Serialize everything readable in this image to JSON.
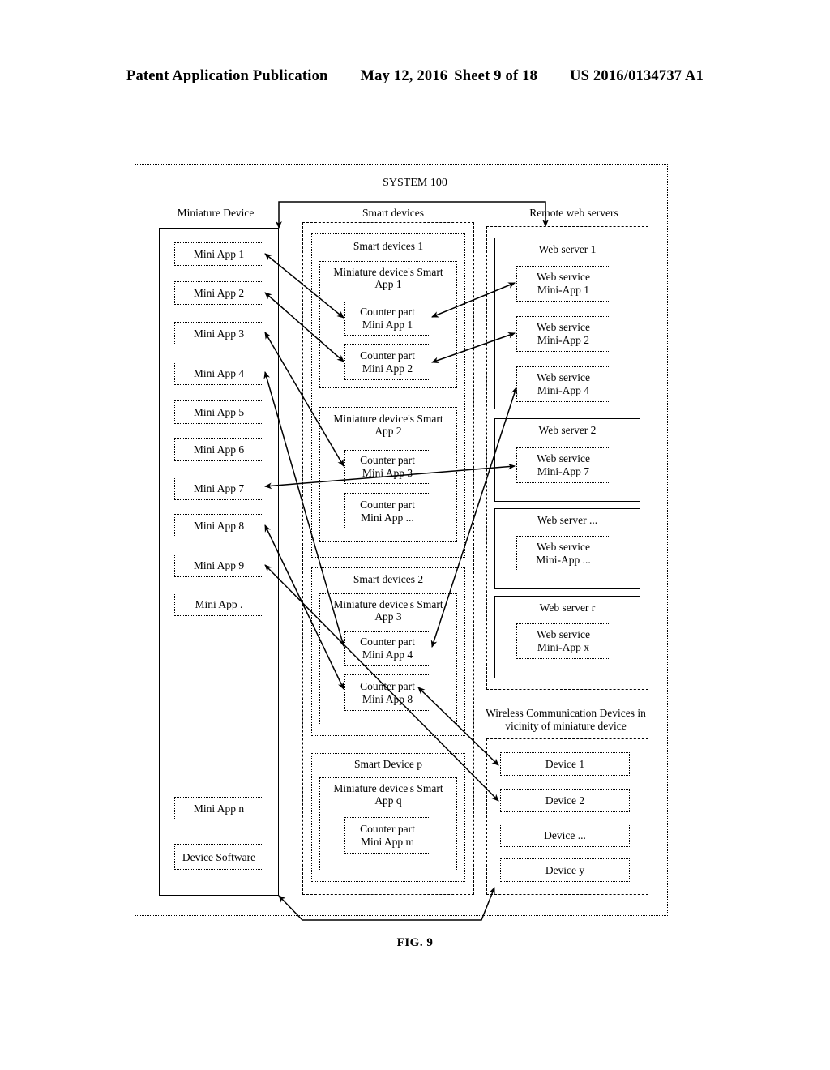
{
  "header": {
    "title": "Patent Application Publication",
    "date": "May 12, 2016",
    "sheet": "Sheet 9 of 18",
    "number": "US 2016/0134737 A1"
  },
  "figure": {
    "label": "FIG. 9",
    "system_title": "SYSTEM 100",
    "columns": {
      "miniature_device": {
        "caption": "Miniature Device",
        "items": [
          {
            "label": "Mini App 1"
          },
          {
            "label": "Mini App 2"
          },
          {
            "label": "Mini App 3"
          },
          {
            "label": "Mini App 4"
          },
          {
            "label": "Mini App 5"
          },
          {
            "label": "Mini App 6"
          },
          {
            "label": "Mini App 7"
          },
          {
            "label": "Mini App 8"
          },
          {
            "label": "Mini App 9"
          },
          {
            "label": "Mini App ."
          },
          {
            "label": "Mini App n"
          },
          {
            "label": "Device Software"
          }
        ]
      },
      "smart_devices": {
        "caption": "Smart devices",
        "groups": [
          {
            "title": "Smart devices 1",
            "apps": [
              {
                "title_line1": "Miniature device's Smart",
                "title_line2": "App 1",
                "parts": [
                  {
                    "line1": "Counter part",
                    "line2": "Mini App 1"
                  },
                  {
                    "line1": "Counter part",
                    "line2": "Mini App 2"
                  }
                ]
              },
              {
                "title_line1": "Miniature device's Smart",
                "title_line2": "App 2",
                "parts": [
                  {
                    "line1": "Counter part",
                    "line2": "Mini App 3"
                  },
                  {
                    "line1": "Counter part",
                    "line2": "Mini App ..."
                  }
                ]
              }
            ]
          },
          {
            "title": "Smart devices 2",
            "apps": [
              {
                "title_line1": "Miniature device's Smart",
                "title_line2": "App 3",
                "parts": [
                  {
                    "line1": "Counter part",
                    "line2": "Mini App 4"
                  },
                  {
                    "line1": "Counter part",
                    "line2": "Mini App 8"
                  }
                ]
              }
            ]
          },
          {
            "title": "Smart Device p",
            "apps": [
              {
                "title_line1": "Miniature device's Smart",
                "title_line2": "App q",
                "parts": [
                  {
                    "line1": "Counter part",
                    "line2": "Mini App m"
                  }
                ]
              }
            ]
          }
        ]
      },
      "remote_web_servers": {
        "caption": "Remote web servers",
        "servers": [
          {
            "title": "Web server 1",
            "services": [
              {
                "line1": "Web service",
                "line2": "Mini-App 1"
              },
              {
                "line1": "Web service",
                "line2": "Mini-App 2"
              },
              {
                "line1": "Web service",
                "line2": "Mini-App 4"
              }
            ]
          },
          {
            "title": "Web server 2",
            "services": [
              {
                "line1": "Web service",
                "line2": "Mini-App 7"
              }
            ]
          },
          {
            "title": "Web server ...",
            "services": [
              {
                "line1": "Web service",
                "line2": "Mini-App ..."
              }
            ]
          },
          {
            "title": "Web server r",
            "services": [
              {
                "line1": "Web service",
                "line2": "Mini-App x"
              }
            ]
          }
        ]
      },
      "wireless_devices": {
        "caption_line1": "Wireless Communication Devices in",
        "caption_line2": "vicinity of miniature device",
        "items": [
          {
            "label": "Device 1"
          },
          {
            "label": "Device 2"
          },
          {
            "label": "Device ..."
          },
          {
            "label": "Device y"
          }
        ]
      }
    }
  }
}
